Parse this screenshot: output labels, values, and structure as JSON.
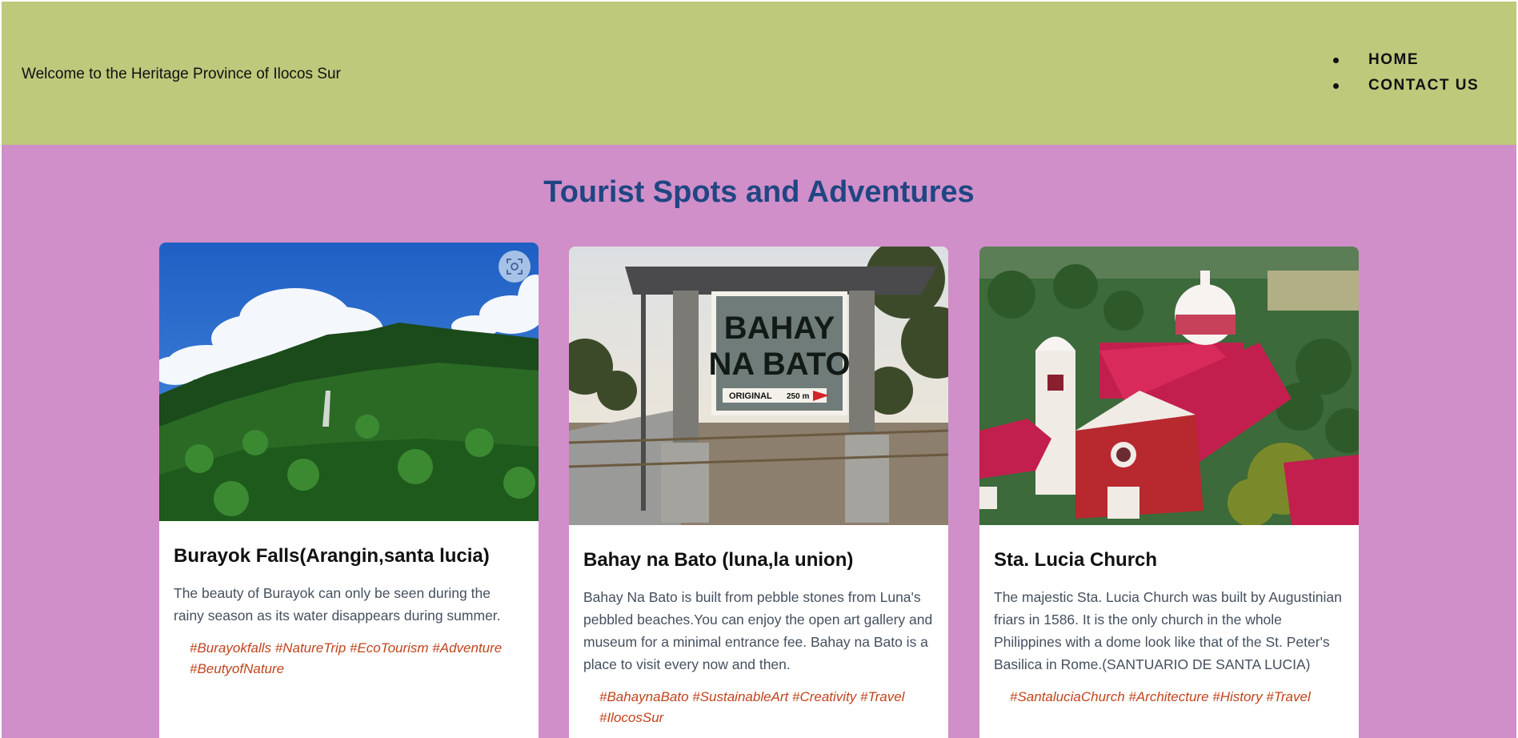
{
  "header": {
    "welcome": "Welcome to the Heritage Province of Ilocos Sur",
    "nav": [
      {
        "label": "HOME"
      },
      {
        "label": "CONTACT US"
      }
    ]
  },
  "main": {
    "title": "Tourist Spots and Adventures",
    "cards": [
      {
        "title": "Burayok Falls(Arangin,santa lucia)",
        "description": "The beauty of Burayok can only be seen during the rainy season as its water disappears during summer.",
        "tags": "#Burayokfalls #NatureTrip #EcoTourism #Adventure #BeutyofNature"
      },
      {
        "title": "Bahay na Bato (luna,la union)",
        "description": "Bahay Na Bato is built from pebble stones from Luna's pebbled beaches.You can enjoy the open art gallery and museum for a minimal entrance fee. Bahay na Bato is a place to visit every now and then.",
        "tags": "#BahaynaBato #SustainableArt #Creativity #Travel #IlocosSur",
        "sign_line1": "BAHAY",
        "sign_line2": "NA BATO",
        "sign_small": "ORIGINAL",
        "sign_distance": "250 m"
      },
      {
        "title": "Sta. Lucia Church",
        "description": "The majestic Sta. Lucia Church was built by Augustinian friars in 1586. It is the only church in the whole Philippines with a dome look like that of the St. Peter's Basilica in Rome.(SANTUARIO DE SANTA LUCIA)",
        "tags": "#SantaluciaChurch #Architecture #History #Travel"
      }
    ]
  },
  "icons": {
    "visual_search": "visual-search-lens-icon",
    "bullet": "bullet-icon"
  },
  "colors": {
    "header_bg": "#bec97c",
    "main_bg": "#d08fc9",
    "title": "#1f4682",
    "tags": "#c0441d"
  }
}
